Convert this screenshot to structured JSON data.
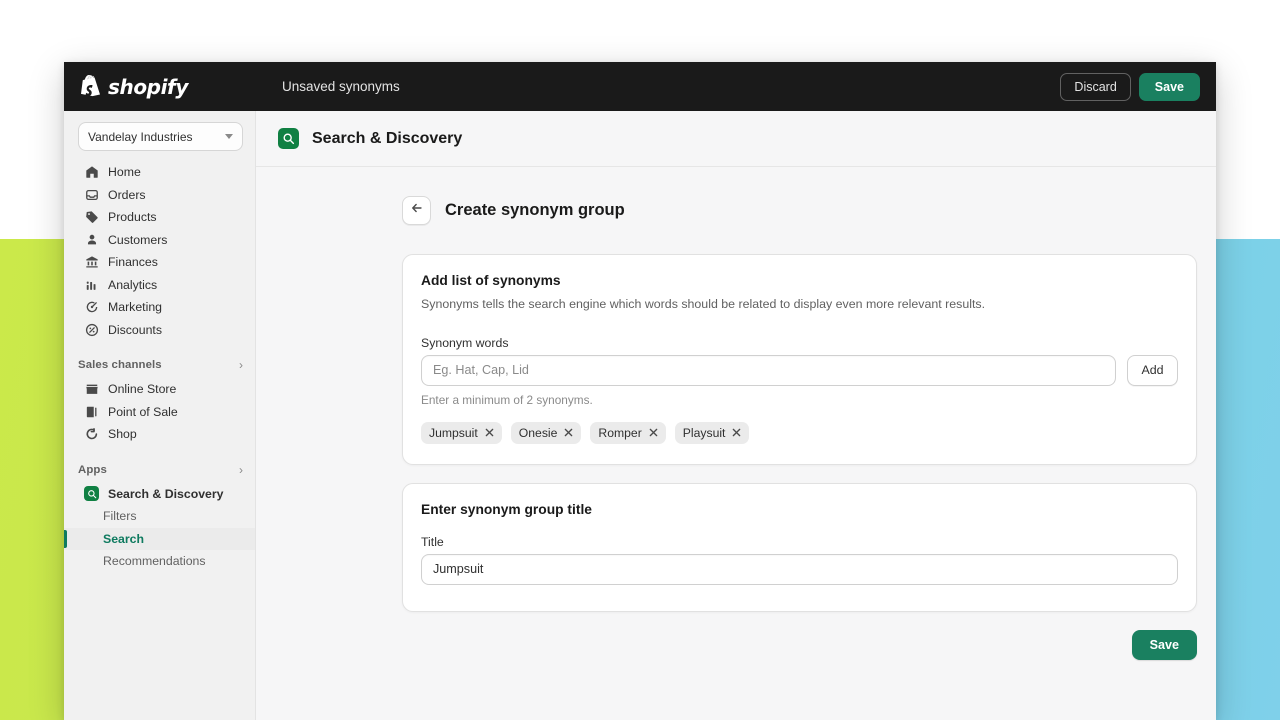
{
  "topbar": {
    "brand": "shopify",
    "brand_icon": "shopify-bag-icon",
    "title": "Unsaved synonyms",
    "discard_label": "Discard",
    "save_label": "Save"
  },
  "sidebar": {
    "store": {
      "name": "Vandelay Industries",
      "icon": "chevron-down-icon"
    },
    "items": [
      {
        "label": "Home",
        "icon": "home-icon"
      },
      {
        "label": "Orders",
        "icon": "orders-inbox-icon"
      },
      {
        "label": "Products",
        "icon": "product-tag-icon"
      },
      {
        "label": "Customers",
        "icon": "customer-person-icon"
      },
      {
        "label": "Finances",
        "icon": "finances-bank-icon"
      },
      {
        "label": "Analytics",
        "icon": "analytics-bars-icon"
      },
      {
        "label": "Marketing",
        "icon": "marketing-megaphone-icon"
      },
      {
        "label": "Discounts",
        "icon": "discount-icon"
      }
    ],
    "sales_channels": {
      "title": "Sales channels",
      "chevron": "›",
      "items": [
        {
          "label": "Online Store",
          "icon": "storefront-icon"
        },
        {
          "label": "Point of Sale",
          "icon": "point-of-sale-icon"
        },
        {
          "label": "Shop",
          "icon": "shop-icon"
        }
      ]
    },
    "apps": {
      "title": "Apps",
      "chevron": "›",
      "app_name": "Search & Discovery",
      "app_icon": "search-discovery-app-icon",
      "sub_items": [
        {
          "label": "Filters",
          "active": false
        },
        {
          "label": "Search",
          "active": true
        },
        {
          "label": "Recommendations",
          "active": false
        }
      ]
    }
  },
  "page_header": {
    "icon": "search-discovery-app-icon",
    "title": "Search & Discovery"
  },
  "breadcrumb": {
    "back_icon": "arrow-left-icon",
    "title": "Create synonym group"
  },
  "synonyms_card": {
    "title": "Add list of synonyms",
    "subtitle": "Synonyms tells the search engine which words should be related to display even more relevant results.",
    "field_label": "Synonym words",
    "input_value": "",
    "input_placeholder": "Eg. Hat, Cap, Lid",
    "add_label": "Add",
    "help_text": "Enter a minimum of 2 synonyms.",
    "chips": [
      {
        "label": "Jumpsuit",
        "remove_icon": "close-icon"
      },
      {
        "label": "Onesie",
        "remove_icon": "close-icon"
      },
      {
        "label": "Romper",
        "remove_icon": "close-icon"
      },
      {
        "label": "Playsuit",
        "remove_icon": "close-icon"
      }
    ]
  },
  "title_card": {
    "title": "Enter synonym group title",
    "field_label": "Title",
    "value": "Jumpsuit",
    "placeholder": ""
  },
  "footer": {
    "save_label": "Save"
  },
  "colors": {
    "brand_green": "#1a8060",
    "app_icon_green": "#108043",
    "topbar_black": "#1a1a1a",
    "active_green": "#0e7a5f",
    "canvas": "#f6f6f7",
    "sidebar": "#f1f1f1"
  }
}
